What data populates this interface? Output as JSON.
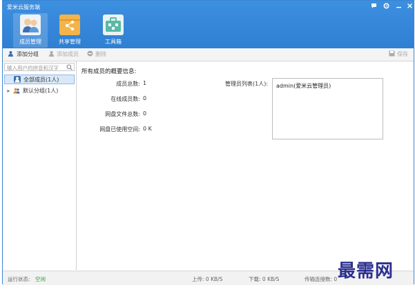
{
  "app": {
    "title": "爱米云服务端",
    "window_controls": [
      "feedback-icon",
      "settings-icon",
      "minimize-icon",
      "close-icon"
    ]
  },
  "nav": [
    {
      "label": "成员管理",
      "icon": "members-icon",
      "active": true
    },
    {
      "label": "共享管理",
      "icon": "share-icon",
      "active": false
    },
    {
      "label": "工具箱",
      "icon": "toolbox-icon",
      "active": false
    }
  ],
  "toolbar": {
    "add_group": "添加分组",
    "add_member": "添加成员",
    "delete": "删除",
    "save": "保存"
  },
  "sidebar": {
    "search_placeholder": "输入用户的拼音和汉字",
    "tree": [
      {
        "label": "全部成员(1人)",
        "selected": true
      },
      {
        "label": "默认分组(1人)",
        "selected": false
      }
    ]
  },
  "overview": {
    "title": "所有成员的概要信息:",
    "stats": [
      {
        "label": "成员总数:",
        "value": "1"
      },
      {
        "label": "在线成员数:",
        "value": "0"
      },
      {
        "label": "网盘文件总数:",
        "value": "0"
      },
      {
        "label": "网盘已使用空间:",
        "value": "0 K"
      }
    ],
    "admin_label": "管理员列表(1人):",
    "admins": [
      "admin(爱米云管理员)"
    ]
  },
  "status": {
    "running_label": "运行状态:",
    "running_value": "空闲",
    "upload": "上传: 0 KB/S",
    "download": "下载: 0 KB/S",
    "connections": "传输连接数: 0"
  },
  "watermark": "最需网",
  "colors": {
    "title_bar": "#2f7fd3",
    "accent": "#3d8fe0",
    "status_ok": "#2e9e2e",
    "watermark": "#2b2f8f"
  }
}
